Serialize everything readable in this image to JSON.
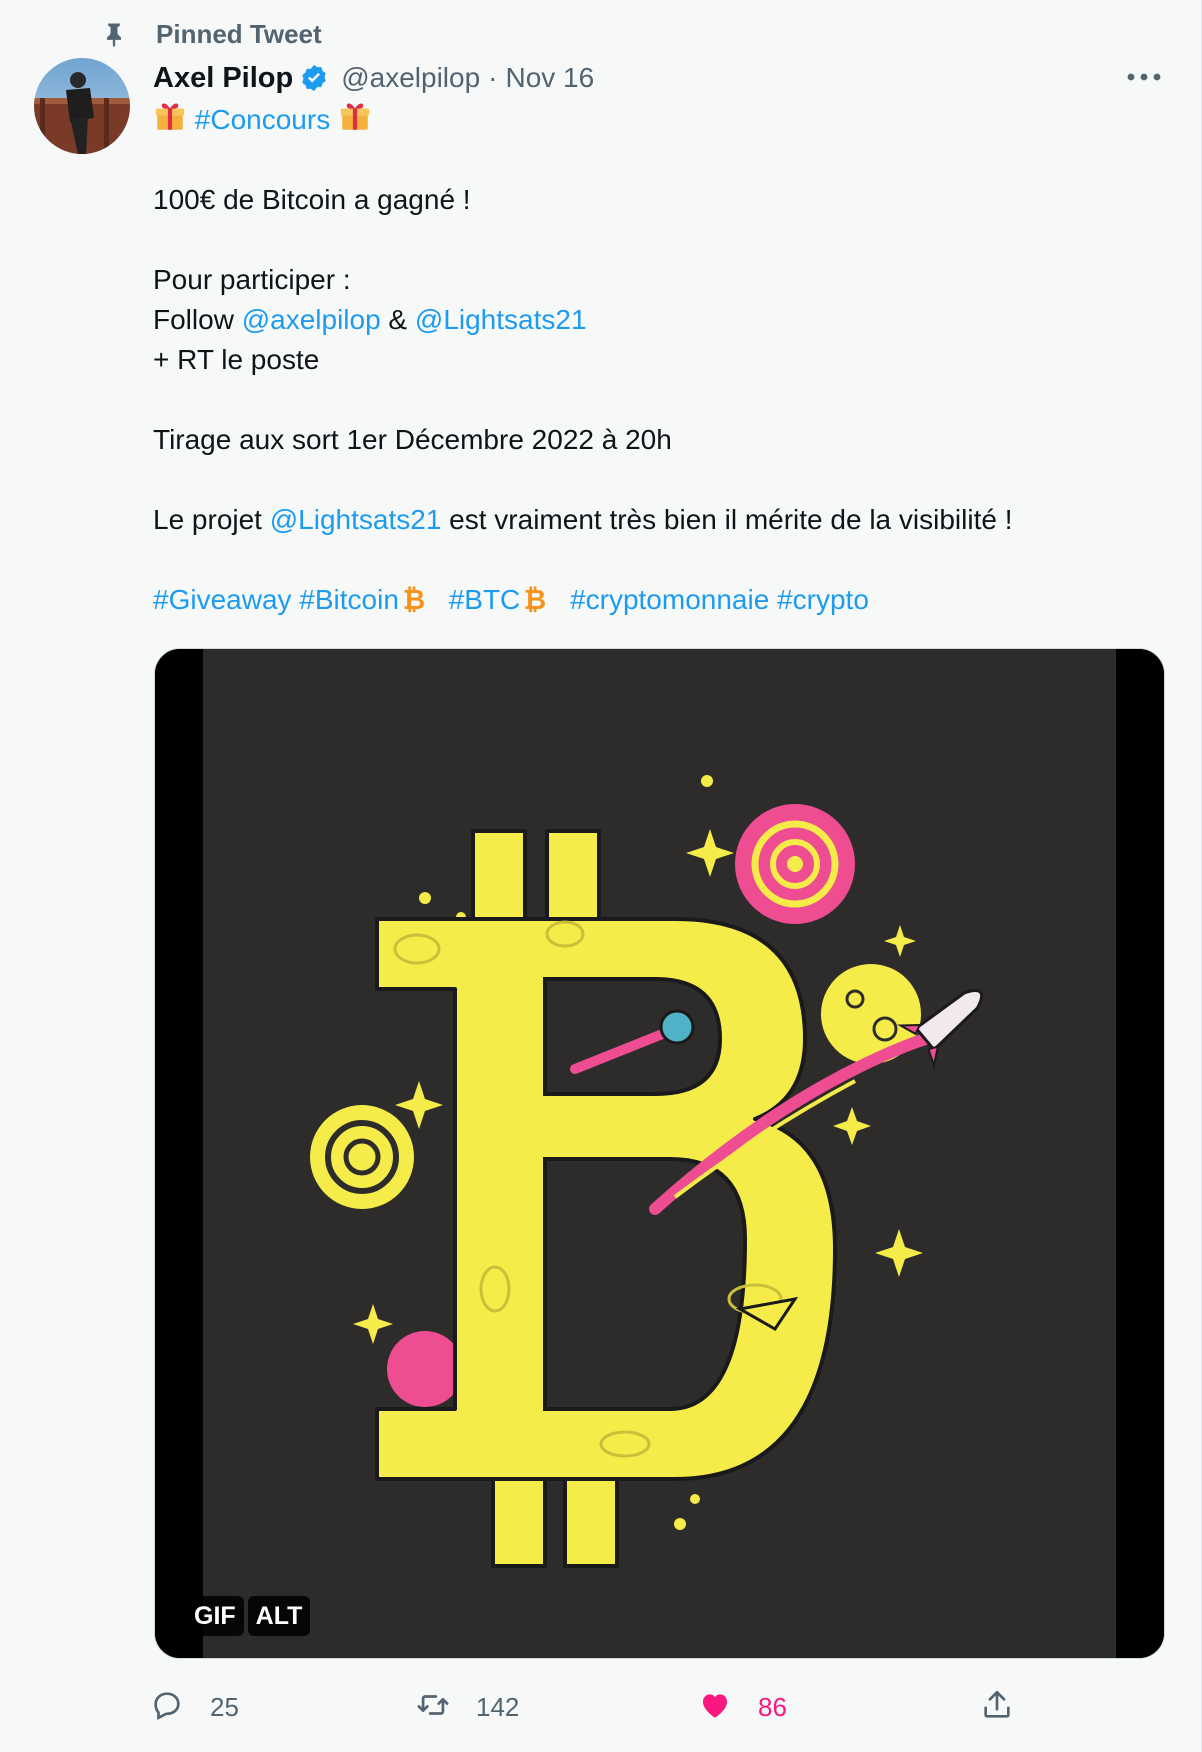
{
  "pinned": {
    "label": "Pinned Tweet"
  },
  "author": {
    "display_name": "Axel Pilop",
    "handle": "@axelpilop",
    "separator": "·",
    "date": "Nov 16"
  },
  "tweet": {
    "hashtag_title": "#Concours",
    "line_prize": "100€ de Bitcoin a gagné !",
    "line_participate": "Pour participer :",
    "follow_prefix": "Follow ",
    "mention_1": "@axelpilop",
    "follow_and": " & ",
    "mention_2": "@Lightsats21",
    "line_rt": "+ RT le poste",
    "line_draw": "Tirage aux sort 1er Décembre 2022 à 20h",
    "project_prefix": "Le projet ",
    "project_mention": "@Lightsats21",
    "project_suffix": " est vraiment très bien il mérite de la visibilité !",
    "tags": [
      "#Giveaway",
      "#Bitcoin",
      "#BTC",
      "#cryptomonnaie",
      "#crypto"
    ]
  },
  "media": {
    "gif_badge": "GIF",
    "alt_badge": "ALT"
  },
  "actions": {
    "reply_count": "25",
    "retweet_count": "142",
    "like_count": "86"
  },
  "colors": {
    "link": "#1d9bf0",
    "like": "#f91880",
    "secondary_text": "#536471",
    "bitcoin_yellow": "#f5ec4a",
    "art_background": "#2d2c2b"
  },
  "icons": [
    "pin-icon",
    "verified-icon",
    "more-icon",
    "gift-icon",
    "bitcoin-emoji-icon",
    "reply-icon",
    "retweet-icon",
    "like-icon",
    "share-icon"
  ]
}
